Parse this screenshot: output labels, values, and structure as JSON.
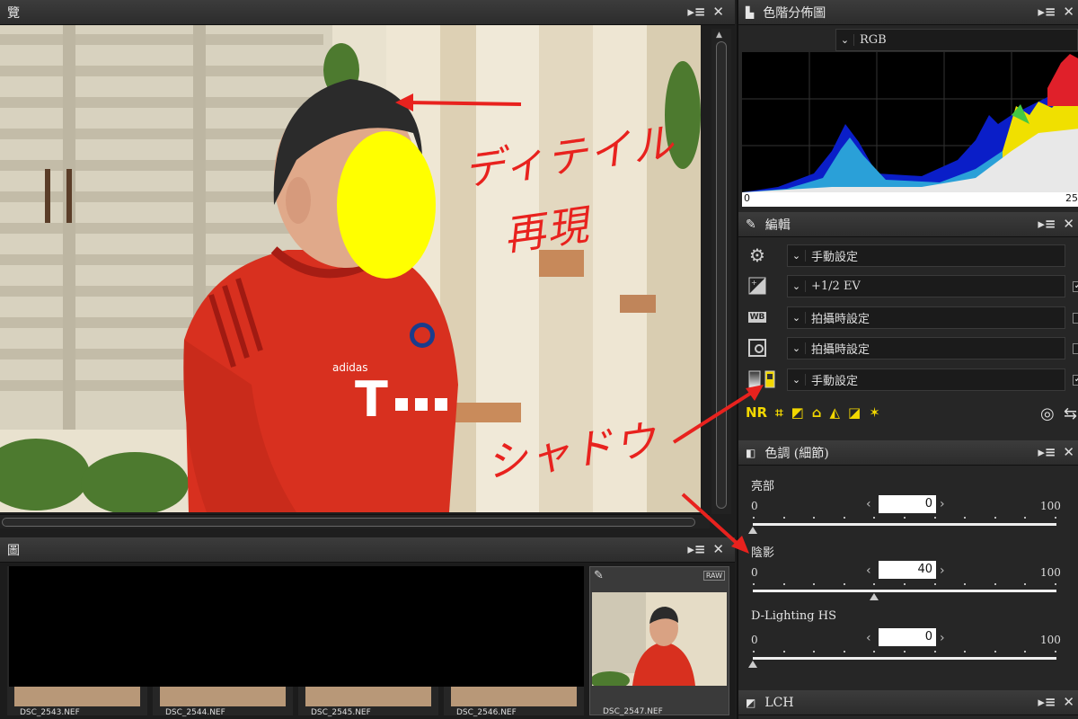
{
  "viewer": {
    "title": "覽"
  },
  "filmstrip": {
    "title": "圖",
    "files": [
      "DSC_2543.NEF",
      "DSC_2544.NEF",
      "DSC_2545.NEF",
      "DSC_2546.NEF",
      "DSC_2547.NEF"
    ],
    "raw_badge": "RAW"
  },
  "histogram": {
    "title": "色階分佈圖",
    "channel": "RGB",
    "axis_min": "0",
    "axis_max": "25"
  },
  "edit": {
    "title": "編輯",
    "rows": [
      {
        "icon": "gear-icon",
        "value": "手動設定",
        "checked": false
      },
      {
        "icon": "exposure-icon",
        "value": "+1/2 EV",
        "checked": true
      },
      {
        "icon": "white-balance-icon",
        "value": "拍攝時設定",
        "checked": false
      },
      {
        "icon": "picture-control-icon",
        "value": "拍攝時設定",
        "checked": false
      },
      {
        "icon": "tone-icon",
        "value": "手動設定",
        "checked": true
      }
    ],
    "wb_label": "WB"
  },
  "tone_detail": {
    "title": "色調 (細節)",
    "sliders": [
      {
        "label": "亮部",
        "min": "0",
        "max": "100",
        "value": "0",
        "level": 0
      },
      {
        "label": "陰影",
        "min": "0",
        "max": "100",
        "value": "40",
        "level": 40
      },
      {
        "label": "D-Lighting HS",
        "min": "0",
        "max": "100",
        "value": "0",
        "level": 0
      }
    ]
  },
  "lch": {
    "title": "LCH"
  },
  "annotations": {
    "detail": "ディテイル",
    "reproduce": "再現",
    "shadow": "シャドウ"
  },
  "colors": {
    "accent_red": "#e8221e",
    "tool_yellow": "#f2d700",
    "jersey_red": "#d8301f",
    "face_yellow": "#ffff00"
  }
}
